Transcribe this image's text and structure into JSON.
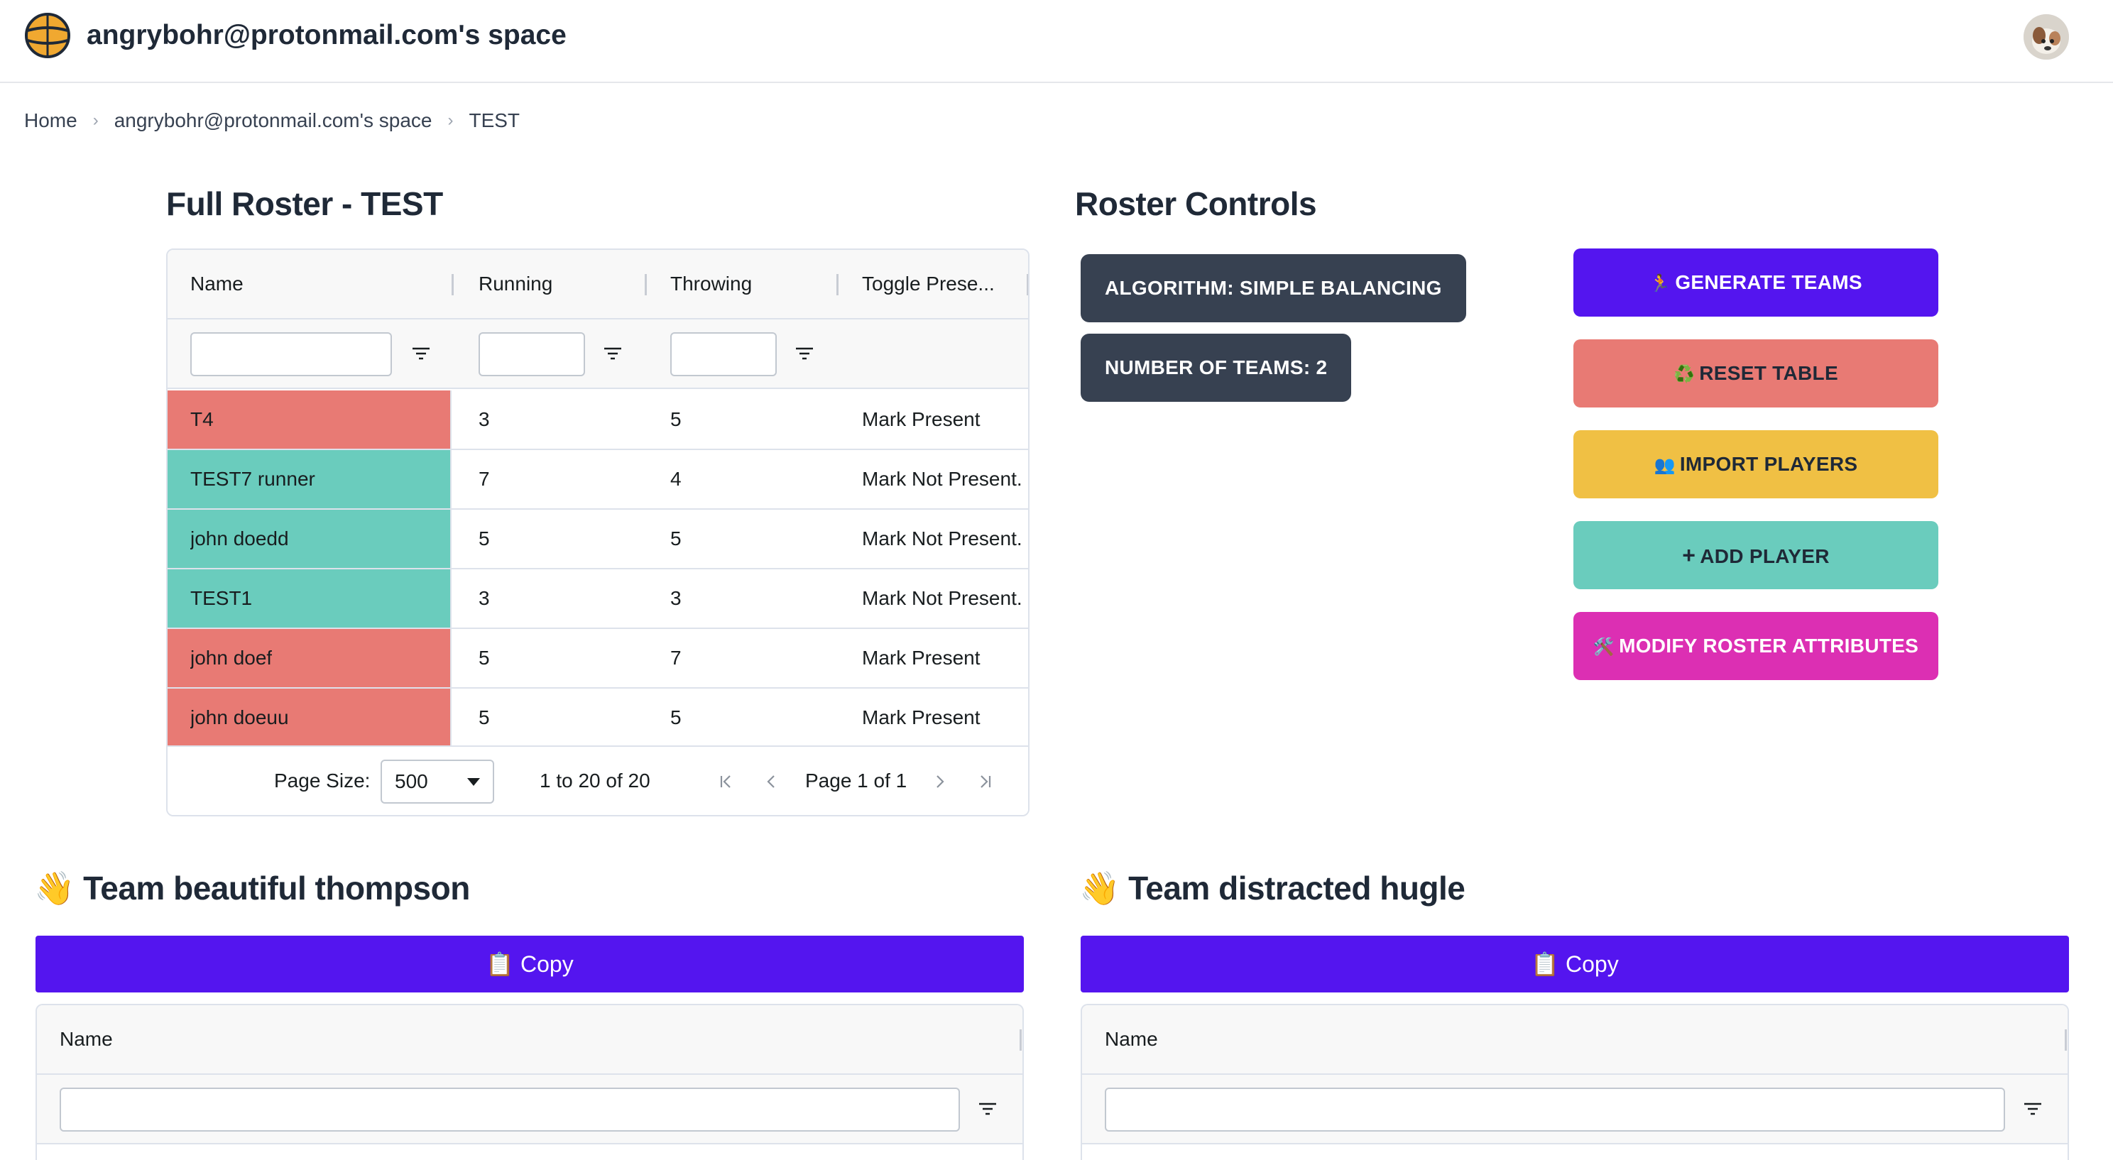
{
  "header": {
    "space_title": "angrybohr@protonmail.com's space",
    "logo_icon": "basketball-icon",
    "avatar_icon": "avatar-image"
  },
  "breadcrumb": {
    "items": [
      "Home",
      "angrybohr@protonmail.com's space",
      "TEST"
    ]
  },
  "roster": {
    "title": "Full Roster - TEST",
    "columns": [
      "Name",
      "Running",
      "Throwing",
      "Toggle Prese..."
    ],
    "rows": [
      {
        "name": "T4",
        "running": "3",
        "throwing": "5",
        "toggle": "Mark Present",
        "status": "present"
      },
      {
        "name": "TEST7 runner",
        "running": "7",
        "throwing": "4",
        "toggle": "Mark Not Present.",
        "status": "not-present"
      },
      {
        "name": "john doedd",
        "running": "5",
        "throwing": "5",
        "toggle": "Mark Not Present.",
        "status": "not-present"
      },
      {
        "name": "TEST1",
        "running": "3",
        "throwing": "3",
        "toggle": "Mark Not Present.",
        "status": "not-present"
      },
      {
        "name": "john doef",
        "running": "5",
        "throwing": "7",
        "toggle": "Mark Present",
        "status": "present"
      },
      {
        "name": "john doeuu",
        "running": "5",
        "throwing": "5",
        "toggle": "Mark Present",
        "status": "present"
      }
    ],
    "footer": {
      "page_size_label": "Page Size:",
      "page_size_value": "500",
      "range_text": "1 to 20 of 20",
      "page_text": "Page 1 of 1"
    }
  },
  "controls": {
    "title": "Roster Controls",
    "algorithm_label": "ALGORITHM: SIMPLE BALANCING",
    "num_teams_label": "NUMBER OF TEAMS: 2",
    "buttons": [
      {
        "emoji": "🏃",
        "label": "GENERATE TEAMS",
        "bg": "#5415ef",
        "fg": "#ffffff"
      },
      {
        "emoji": "♻️",
        "label": "RESET TABLE",
        "bg": "#e87a74",
        "fg": "#1f2937"
      },
      {
        "emoji": "👥",
        "label": "IMPORT PLAYERS",
        "bg": "#f0c044",
        "fg": "#1f2937"
      },
      {
        "emoji": "+",
        "label": "ADD PLAYER",
        "bg": "#6accbd",
        "fg": "#1f2937"
      },
      {
        "emoji": "🛠️",
        "label": "MODIFY ROSTER ATTRIBUTES",
        "bg": "#dc2fb3",
        "fg": "#ffffff"
      }
    ]
  },
  "teams": [
    {
      "emoji": "👋",
      "title": "Team beautiful thompson",
      "copy_emoji": "📋",
      "copy_label": "Copy",
      "column": "Name"
    },
    {
      "emoji": "👋",
      "title": "Team distracted hugle",
      "copy_emoji": "📋",
      "copy_label": "Copy",
      "column": "Name"
    }
  ],
  "colors": {
    "present": "#e87a74",
    "not_present": "#6accbd",
    "primary": "#5415ef"
  }
}
